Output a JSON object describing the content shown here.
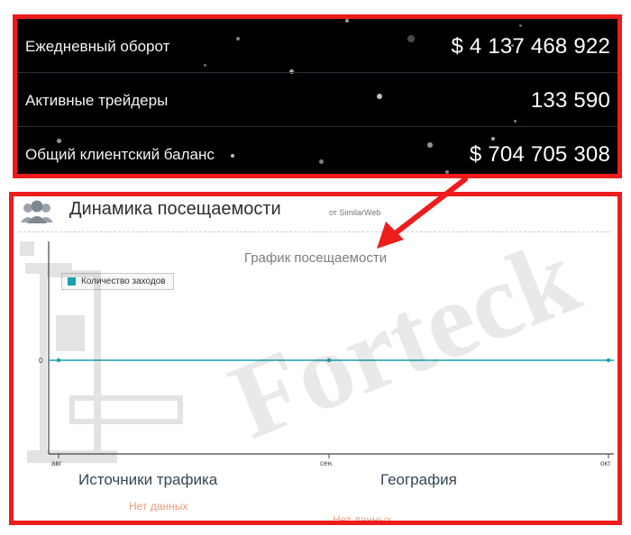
{
  "stats": {
    "items": [
      {
        "label": "Ежедневный оборот",
        "value": "$ 4 137 468 922"
      },
      {
        "label": "Активные трейдеры",
        "value": "133 590"
      },
      {
        "label": "Общий клиентский баланс",
        "value": "$ 704 705 308"
      }
    ]
  },
  "traffic": {
    "title": "Динамика посещаемости",
    "source": "от SimilarWeb",
    "chart_title": "График посещаемости",
    "sources_heading": "Источники трафика",
    "sources_empty": "Нет данных",
    "geography_heading": "География",
    "geography_empty": "Нет данных"
  },
  "chart_data": {
    "type": "line",
    "title": "График посещаемости",
    "x": [
      "авг",
      "сен.",
      "окт"
    ],
    "series": [
      {
        "name": "Количество заходов",
        "values": [
          0,
          0,
          0
        ]
      }
    ],
    "y_ticks": [
      "0"
    ],
    "grid": false,
    "legend_position": "top-left"
  },
  "watermark": {
    "text": "Forteck"
  },
  "colors": {
    "highlight_border": "#ee1c1c",
    "series": "#17a2b2",
    "stats_bg": "#000000",
    "empty_text": "#f09a7a"
  }
}
